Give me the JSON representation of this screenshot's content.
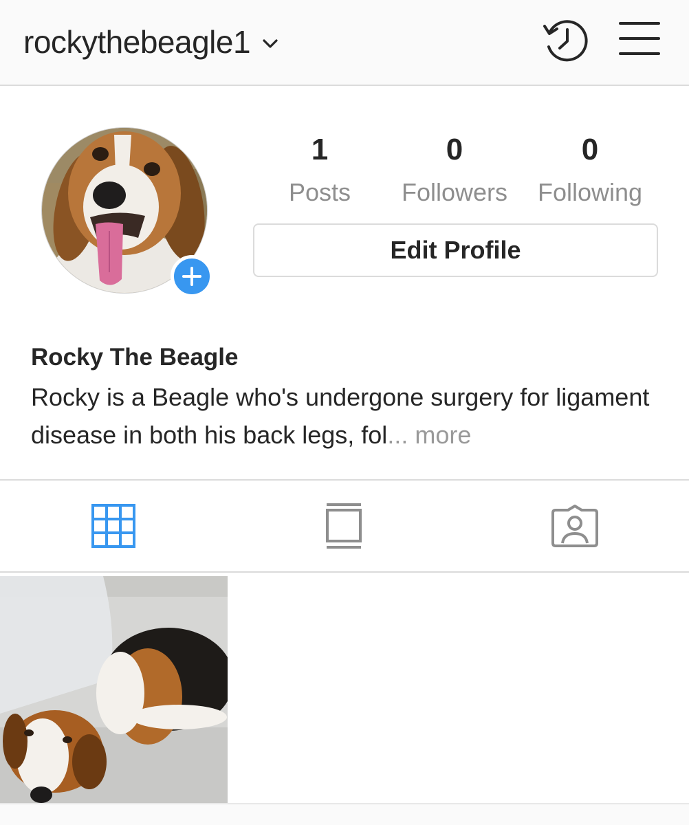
{
  "header": {
    "username": "rockythebeagle1",
    "icons": {
      "dropdown": "chevron-down-icon",
      "history": "history-clock-icon",
      "menu": "hamburger-menu-icon"
    }
  },
  "profile": {
    "avatar": "beagle-avatar-photo",
    "stats": [
      {
        "value": "1",
        "label": "Posts"
      },
      {
        "value": "0",
        "label": "Followers"
      },
      {
        "value": "0",
        "label": "Following"
      }
    ],
    "edit_button": "Edit Profile",
    "full_name": "Rocky The Beagle",
    "bio": "Rocky is a Beagle who's undergone surgery for ligament disease in both his back legs, fol",
    "bio_ellipsis": "...",
    "more_label": "more"
  },
  "tabs": [
    {
      "name": "grid",
      "icon": "grid-icon",
      "active": true
    },
    {
      "name": "feed",
      "icon": "feed-icon",
      "active": false
    },
    {
      "name": "tagged",
      "icon": "tagged-person-icon",
      "active": false
    }
  ],
  "colors": {
    "accent": "#3897f0",
    "text": "#262626",
    "muted": "#8e8e8e",
    "border": "#dbdbdb",
    "topbar_bg": "#fafafa"
  },
  "posts": [
    {
      "thumbnail": "beagle-in-cone-photo"
    }
  ]
}
